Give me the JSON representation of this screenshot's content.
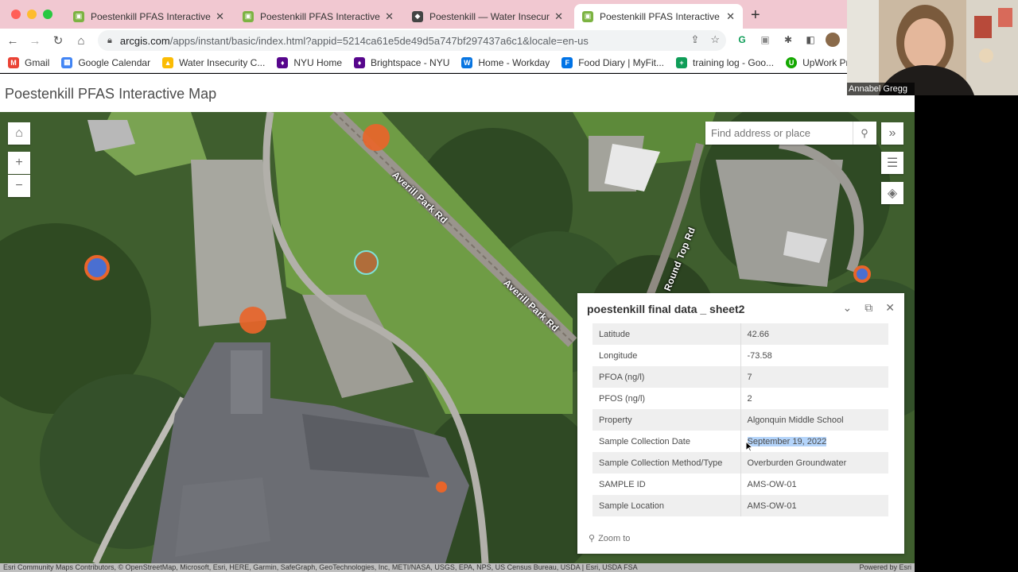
{
  "browser": {
    "tabs": [
      {
        "title": "Poestenkill PFAS Interactive Map",
        "icon": "green-app-icon",
        "active": false
      },
      {
        "title": "Poestenkill PFAS Interactive Map",
        "icon": "green-app-icon",
        "active": false
      },
      {
        "title": "Poestenkill — Water Insecurity",
        "icon": "cube-icon",
        "active": false
      },
      {
        "title": "Poestenkill PFAS Interactive Map",
        "icon": "green-app-icon",
        "active": true
      }
    ],
    "url_host": "arcgis.com",
    "url_path": "/apps/instant/basic/index.html?appid=5214ca61e5de49d5a747bf297437a6c1&locale=en-us",
    "bookmarks": [
      {
        "label": "Gmail",
        "color": "#ea4335",
        "glyph": "M"
      },
      {
        "label": "Google Calendar",
        "color": "#4285f4",
        "glyph": "▦"
      },
      {
        "label": "Water Insecurity C...",
        "color": "#fbbc04",
        "glyph": "▲"
      },
      {
        "label": "NYU Home",
        "color": "#57068c",
        "glyph": "♦"
      },
      {
        "label": "Brightspace - NYU",
        "color": "#57068c",
        "glyph": "♦"
      },
      {
        "label": "Home - Workday",
        "color": "#0875e1",
        "glyph": "W"
      },
      {
        "label": "Food Diary | MyFit...",
        "color": "#0073e6",
        "glyph": "F"
      },
      {
        "label": "training log - Goo...",
        "color": "#0f9d58",
        "glyph": "+"
      },
      {
        "label": "UpWork Proposals",
        "color": "#14a800",
        "glyph": "U"
      }
    ]
  },
  "app": {
    "title": "Poestenkill PFAS Interactive Map",
    "search_placeholder": "Find address or place",
    "road_labels": [
      "Averill Park Rd",
      "Averill Park Rd",
      "Round Top Rd"
    ]
  },
  "popup": {
    "title": "poestenkill final data _ sheet2",
    "rows": [
      {
        "key": "Latitude",
        "value": "42.66"
      },
      {
        "key": "Longitude",
        "value": "-73.58"
      },
      {
        "key": "PFOA (ng/l)",
        "value": "7"
      },
      {
        "key": "PFOS (ng/l)",
        "value": "2"
      },
      {
        "key": "Property",
        "value": "Algonquin Middle School"
      },
      {
        "key": "Sample Collection Date",
        "value": "September 19, 2022"
      },
      {
        "key": "Sample Collection Method/Type",
        "value": "Overburden Groundwater"
      },
      {
        "key": "SAMPLE ID",
        "value": "AMS-OW-01"
      },
      {
        "key": "Sample Location",
        "value": "AMS-OW-01"
      }
    ],
    "zoom_label": "Zoom to"
  },
  "attribution": "Esri Community Maps Contributors, © OpenStreetMap, Microsoft, Esri, HERE, Garmin, SafeGraph, GeoTechnologies, Inc, METI/NASA, USGS, EPA, NPS, US Census Bureau, USDA | Esri, USDA FSA",
  "powered_by": "Powered by Esri",
  "participant_name": "Annabel Gregg",
  "colors": {
    "marker_orange": "#e8652a",
    "marker_blue": "#4a6fd1",
    "marker_brown": "#b06d3a",
    "selection": "#b4d4fa"
  }
}
